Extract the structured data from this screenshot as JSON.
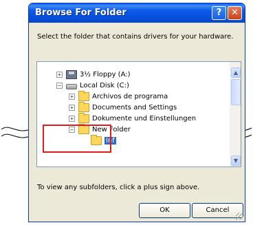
{
  "window": {
    "title": "Browse For Folder",
    "help_button": "?",
    "close_button": "✕"
  },
  "prompt": "Select the folder that contains drivers for your hardware.",
  "tree": {
    "items": [
      {
        "label": "3½ Floppy (A:)",
        "expander": "+",
        "icon": "floppy-icon"
      },
      {
        "label": "Local Disk (C:)",
        "expander": "−",
        "icon": "hard-drive-icon"
      },
      {
        "label": "Archivos de programa",
        "expander": "+",
        "icon": "folder-icon"
      },
      {
        "label": "Documents and Settings",
        "expander": "+",
        "icon": "folder-icon"
      },
      {
        "label": "Dokumente und Einstellungen",
        "expander": "+",
        "icon": "folder-icon"
      },
      {
        "label": "New Folder",
        "expander": "−",
        "icon": "folder-icon"
      },
      {
        "label": "Inf",
        "expander": "",
        "icon": "open-folder-icon",
        "selected": true
      }
    ]
  },
  "hint": "To view any subfolders, click a plus sign above.",
  "buttons": {
    "ok": "OK",
    "cancel": "Cancel"
  },
  "colors": {
    "title_bar": "#0a5ee8",
    "selection": "#316ac5",
    "highlight_box": "#e21a1a"
  }
}
